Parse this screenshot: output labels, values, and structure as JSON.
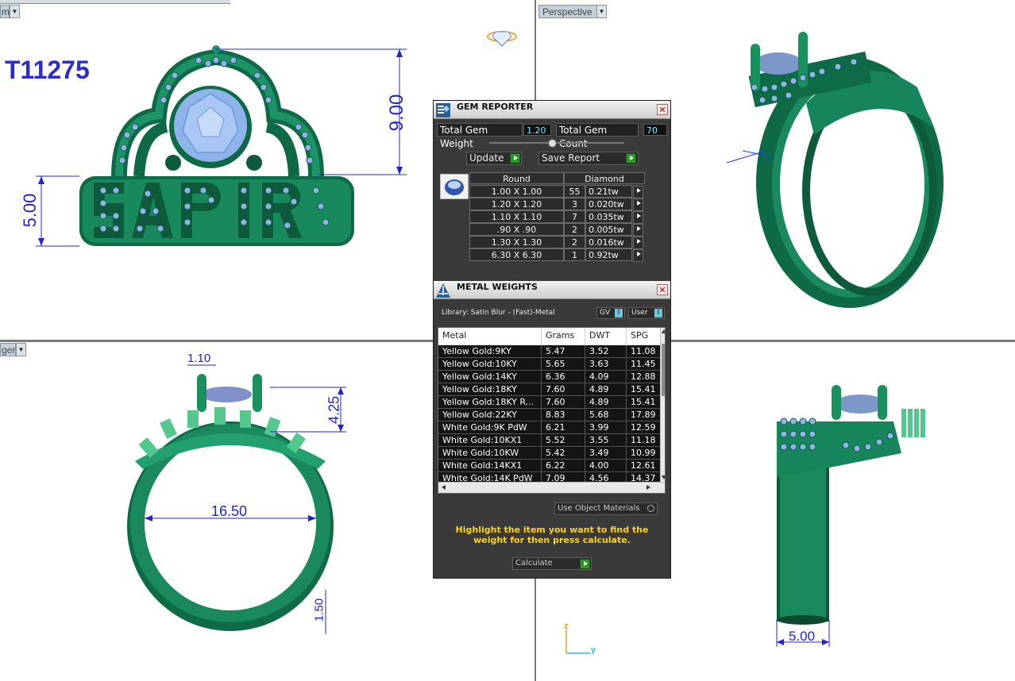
{
  "top_strip": {
    "label": "m"
  },
  "viewports": {
    "top_left": {
      "part_number": "T11275",
      "dims": {
        "height_top": "9.00",
        "height_band": "5.00"
      }
    },
    "top_right": {
      "label": "Perspective"
    },
    "bottom_left": {
      "label": "ger",
      "dims": {
        "prong": "1.10",
        "crown_height": "4.25",
        "inner_diameter": "16.50",
        "shank": "1.50"
      }
    },
    "bottom_right": {
      "dims": {
        "width": "5.00"
      }
    }
  },
  "gem_reporter": {
    "title": "GEM REPORTER",
    "total_weight_label": "Total Gem Weight",
    "total_weight_value": "1.20",
    "total_count_label": "Total Gem Count",
    "total_count_value": "70",
    "update_label": "Update",
    "save_report_label": "Save Report",
    "shape_header": "Round",
    "material_header": "Diamond",
    "rows": [
      {
        "size": "1.00 X 1.00",
        "count": "55",
        "tw": "0.21tw"
      },
      {
        "size": "1.20 X 1.20",
        "count": "3",
        "tw": "0.020tw"
      },
      {
        "size": "1.10 X 1.10",
        "count": "7",
        "tw": "0.035tw"
      },
      {
        "size": ".90 X .90",
        "count": "2",
        "tw": "0.005tw"
      },
      {
        "size": "1.30 X 1.30",
        "count": "2",
        "tw": "0.016tw"
      },
      {
        "size": "6.30 X 6.30",
        "count": "1",
        "tw": "0.92tw"
      }
    ]
  },
  "metal_weights": {
    "title": "METAL WEIGHTS",
    "library": "Library: Satin Blur - (Fast)-Metal",
    "gv_label": "GV",
    "user_label": "User",
    "columns": [
      "Metal",
      "Grams",
      "DWT",
      "SPG"
    ],
    "rows": [
      [
        "Yellow Gold:9KY",
        "5.47",
        "3.52",
        "11.08"
      ],
      [
        "Yellow Gold:10KY",
        "5.65",
        "3.63",
        "11.45"
      ],
      [
        "Yellow Gold:14KY",
        "6.36",
        "4.09",
        "12.88"
      ],
      [
        "Yellow Gold:18KY",
        "7.60",
        "4.89",
        "15.41"
      ],
      [
        "Yellow Gold:18KY R...",
        "7.60",
        "4.89",
        "15.41"
      ],
      [
        "Yellow Gold:22KY",
        "8.83",
        "5.68",
        "17.89"
      ],
      [
        "White Gold:9K PdW",
        "6.21",
        "3.99",
        "12.59"
      ],
      [
        "White Gold:10KX1",
        "5.52",
        "3.55",
        "11.18"
      ],
      [
        "White Gold:10KW",
        "5.42",
        "3.49",
        "10.99"
      ],
      [
        "White Gold:14KX1",
        "6.22",
        "4.00",
        "12.61"
      ],
      [
        "White Gold:14K PdW",
        "7.09",
        "4.56",
        "14.37"
      ]
    ],
    "use_object_materials": "Use Object Materials",
    "hint": "Highlight the item you want to find the weight for then press calculate.",
    "calculate_label": "Calculate"
  },
  "axis": {
    "z": "z",
    "y": "y"
  },
  "colors": {
    "ring_green": "#14825a",
    "gem_blue": "#8fb4ec",
    "dim_blue": "#2424c8",
    "panel_bg": "#3a3a3a"
  }
}
